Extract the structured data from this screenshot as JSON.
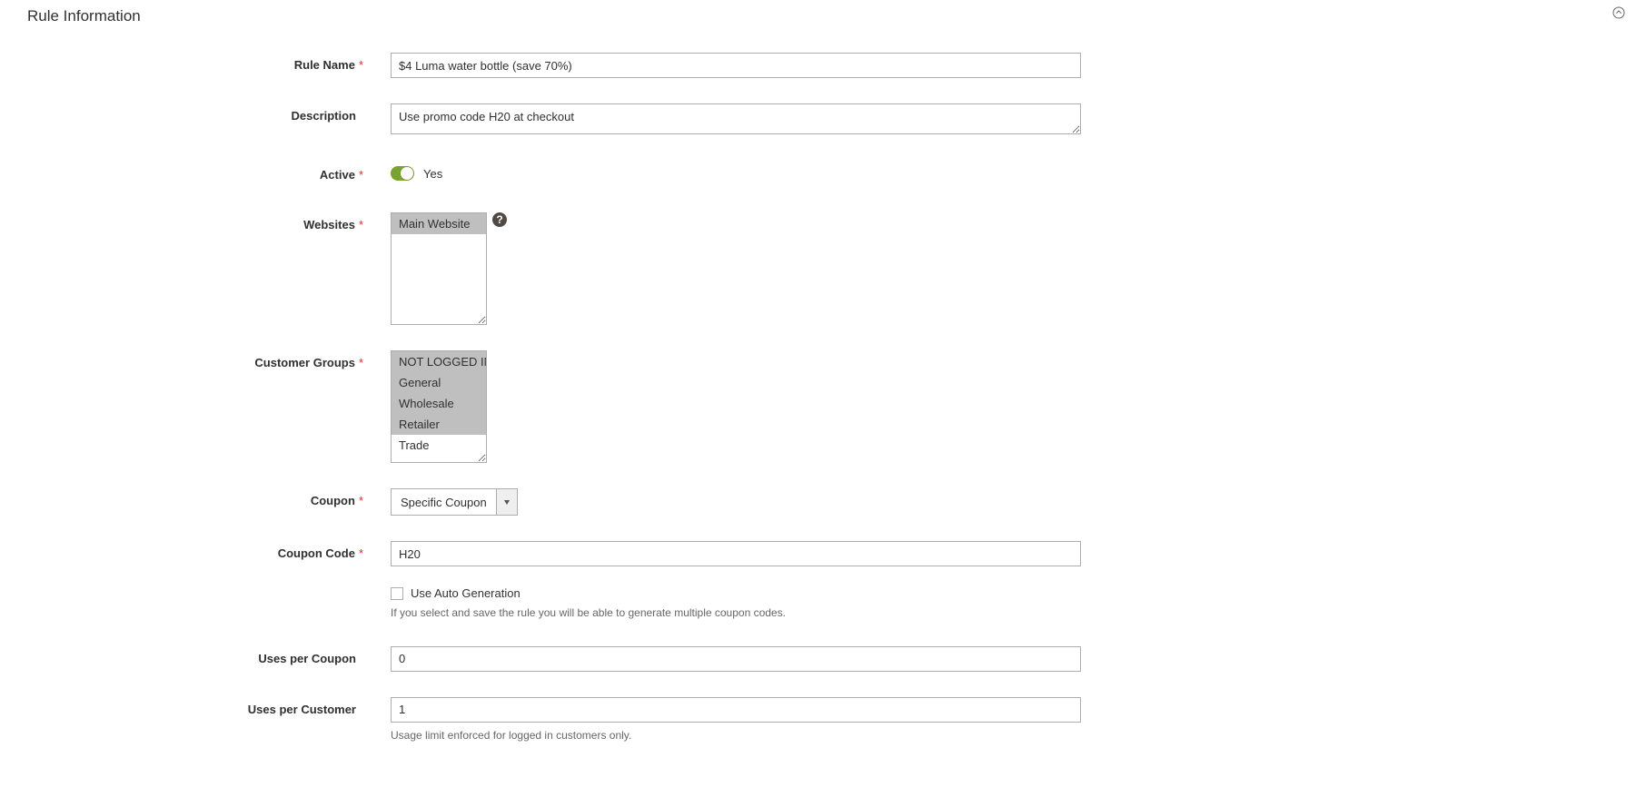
{
  "section": {
    "title": "Rule Information"
  },
  "fields": {
    "rule_name": {
      "label": "Rule Name",
      "required": true,
      "value": "$4 Luma water bottle (save 70%)"
    },
    "description": {
      "label": "Description",
      "required": false,
      "value": "Use promo code H20 at checkout"
    },
    "active": {
      "label": "Active",
      "required": true,
      "value_label": "Yes",
      "on": true
    },
    "websites": {
      "label": "Websites",
      "required": true,
      "options": [
        {
          "label": "Main Website",
          "selected": true
        }
      ]
    },
    "customer_groups": {
      "label": "Customer Groups",
      "required": true,
      "options": [
        {
          "label": "NOT LOGGED IN",
          "selected": true
        },
        {
          "label": "General",
          "selected": true
        },
        {
          "label": "Wholesale",
          "selected": true
        },
        {
          "label": "Retailer",
          "selected": true
        },
        {
          "label": "Trade",
          "selected": false
        }
      ]
    },
    "coupon": {
      "label": "Coupon",
      "required": true,
      "value": "Specific Coupon"
    },
    "coupon_code": {
      "label": "Coupon Code",
      "required": true,
      "value": "H20"
    },
    "auto_gen": {
      "checkbox_label": "Use Auto Generation",
      "checked": false,
      "note": "If you select and save the rule you will be able to generate multiple coupon codes."
    },
    "uses_per_coupon": {
      "label": "Uses per Coupon",
      "required": false,
      "value": "0"
    },
    "uses_per_customer": {
      "label": "Uses per Customer",
      "required": false,
      "value": "1",
      "note": "Usage limit enforced for logged in customers only."
    }
  }
}
